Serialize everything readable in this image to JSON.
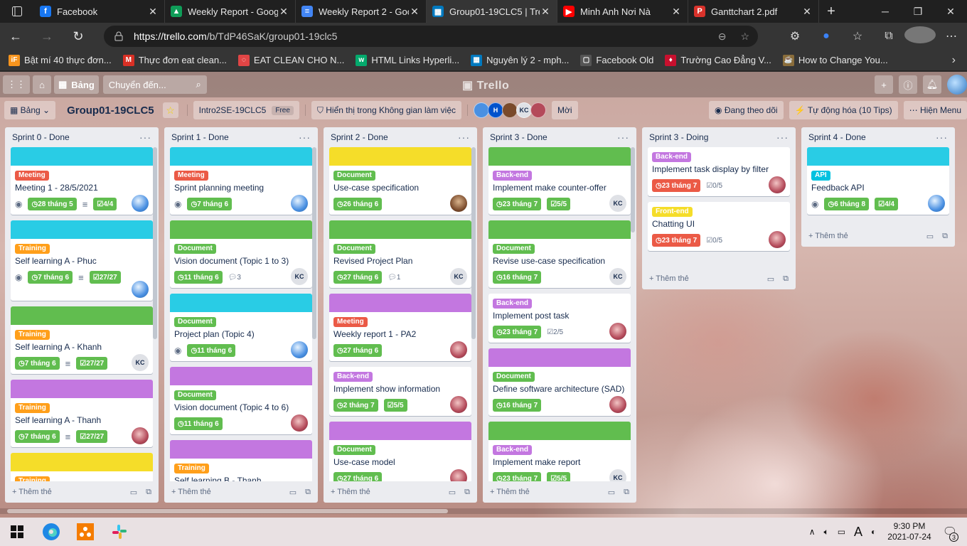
{
  "browser": {
    "tabs": [
      {
        "label": "Facebook",
        "fav_color": "#1877f2",
        "fav_text": "f"
      },
      {
        "label": "Weekly Report - Goog",
        "fav_color": "#0f9d58",
        "fav_text": "▲"
      },
      {
        "label": "Weekly Report 2 - Goo",
        "fav_color": "#4285f4",
        "fav_text": "≡"
      },
      {
        "label": "Group01-19CLC5 | Tre",
        "fav_color": "#0079bf",
        "fav_text": "▦"
      },
      {
        "label": "Minh Anh Nơi Nà",
        "fav_color": "#ff0000",
        "fav_text": "▶"
      },
      {
        "label": "Ganttchart 2.pdf",
        "fav_color": "#d9322b",
        "fav_text": "P"
      }
    ],
    "url_host": "https://trello.com",
    "url_path": "/b/TdP46SaK/group01-19clc5",
    "bookmarks": [
      {
        "label": "Bật mí 40 thực đơn...",
        "fav_color": "#f7941d",
        "fav_text": "iF"
      },
      {
        "label": "Thực đơn eat clean...",
        "fav_color": "#d93025",
        "fav_text": "M"
      },
      {
        "label": "EAT CLEAN CHO N...",
        "fav_color": "#e04545",
        "fav_text": "◌"
      },
      {
        "label": "HTML Links Hyperli...",
        "fav_color": "#04aa6d",
        "fav_text": "w"
      },
      {
        "label": "Nguyên lý 2 - mph...",
        "fav_color": "#0079bf",
        "fav_text": "▦"
      },
      {
        "label": "Facebook Old",
        "fav_color": "#555555",
        "fav_text": "▢"
      },
      {
        "label": "Trường Cao Đẳng V...",
        "fav_color": "#c8102e",
        "fav_text": "♦"
      },
      {
        "label": "How to Change You...",
        "fav_color": "#8a6d3b",
        "fav_text": "☕"
      }
    ]
  },
  "trello": {
    "home_label": "Bảng",
    "search_placeholder": "Chuyển đến...",
    "logo": "Trello",
    "board_btn": "Bảng",
    "board_title": "Group01-19CLC5",
    "workspace": "Intro2SE-19CLC5",
    "free_badge": "Free",
    "visibility": "Hiển thị trong Không gian làm việc",
    "invite": "Mời",
    "following": "Đang theo dõi",
    "automation": "Tự động hóa (10 Tips)",
    "menu": "Hiện Menu",
    "add_card": "Thêm thẻ",
    "members": [
      {
        "text": "",
        "color": "#4a90e2"
      },
      {
        "text": "H",
        "color": "#0052cc"
      },
      {
        "text": "",
        "color": "#7a4a2b"
      },
      {
        "text": "KC",
        "color": "#dfe1e6"
      },
      {
        "text": "",
        "color": "#b44a5a"
      }
    ]
  },
  "colors": {
    "green": "#61bd4f",
    "cyan": "#29cce5",
    "purple": "#c377e0",
    "yellow": "#f5dd29",
    "red": "#eb5a46",
    "orange": "#ff9f1a",
    "sky": "#00c2e0"
  },
  "lists": [
    {
      "title": "Sprint 0 - Done",
      "cards": [
        {
          "cover": "cyan",
          "label": "Meeting",
          "label_color": "red",
          "title": "Meeting 1 - 28/5/2021",
          "eye": true,
          "date": "28 tháng 5",
          "desc": true,
          "check": "4/4",
          "avatar": "blue"
        },
        {
          "cover": "cyan",
          "label": "Training",
          "label_color": "orange",
          "title": "Self learning A - Phuc",
          "eye": true,
          "date": "7 tháng 6",
          "desc": true,
          "check": "27/27",
          "avatar": "blue",
          "avatar_row": true
        },
        {
          "cover": "green",
          "label": "Training",
          "label_color": "orange",
          "title": "Self learning A - Khanh",
          "date": "7 tháng 6",
          "desc": true,
          "check": "27/27",
          "avatar": "kc"
        },
        {
          "cover": "purple",
          "label": "Training",
          "label_color": "orange",
          "title": "Self learning A - Thanh",
          "date": "7 tháng 6",
          "desc": true,
          "check": "27/27",
          "avatar": "flower"
        },
        {
          "cover": "yellow",
          "label": "Training",
          "label_color": "orange",
          "title": "",
          "partial": true
        }
      ]
    },
    {
      "title": "Sprint 1 - Done",
      "cards": [
        {
          "cover": "cyan",
          "label": "Meeting",
          "label_color": "red",
          "title": "Sprint planning meeting",
          "eye": true,
          "date": "7 tháng 6",
          "avatar": "blue"
        },
        {
          "cover": "green",
          "label": "Document",
          "label_color": "green",
          "title": "Vision document (Topic 1 to 3)",
          "date": "11 tháng 6",
          "comments": "3",
          "avatar": "kc"
        },
        {
          "cover": "cyan",
          "label": "Document",
          "label_color": "green",
          "title": "Project plan (Topic 4)",
          "eye": true,
          "date": "11 tháng 6",
          "avatar": "blue"
        },
        {
          "cover": "purple",
          "label": "Document",
          "label_color": "green",
          "title": "Vision document (Topic 4 to 6)",
          "date": "11 tháng 6",
          "avatar": "flower"
        },
        {
          "cover": "purple",
          "label": "Training",
          "label_color": "orange",
          "title": "Self learning B - Thanh",
          "partial": true
        }
      ]
    },
    {
      "title": "Sprint 2 - Done",
      "cards": [
        {
          "cover": "yellow",
          "label": "Document",
          "label_color": "green",
          "title": "Use-case specification",
          "date": "26 tháng 6",
          "avatar": "photo"
        },
        {
          "cover": "green",
          "label": "Document",
          "label_color": "green",
          "title": "Revised Project Plan",
          "date": "27 tháng 6",
          "comments": "1",
          "avatar": "kc"
        },
        {
          "cover": "purple",
          "label": "Meeting",
          "label_color": "red",
          "title": "Weekly report 1 - PA2",
          "date": "27 tháng 6",
          "avatar": "flower"
        },
        {
          "cover": "",
          "label": "Back-end",
          "label_color": "purple",
          "title": "Implement show information",
          "date": "2 tháng 7",
          "check": "5/5",
          "avatar": "flower"
        },
        {
          "cover": "purple",
          "label": "Document",
          "label_color": "green",
          "title": "Use-case model",
          "date": "27 tháng 6",
          "avatar": "flower"
        }
      ]
    },
    {
      "title": "Sprint 3 - Done",
      "cards": [
        {
          "cover": "green",
          "label": "Back-end",
          "label_color": "purple",
          "title": "Implement make counter-offer",
          "date": "23 tháng 7",
          "check": "5/5",
          "avatar": "kc"
        },
        {
          "cover": "green",
          "label": "Document",
          "label_color": "green",
          "title": "Revise use-case specification",
          "date": "16 tháng 7",
          "avatar": "kc"
        },
        {
          "cover": "",
          "label": "Back-end",
          "label_color": "purple",
          "title": "Implement post task",
          "date": "23 tháng 7",
          "check_plain": "2/5",
          "avatar": "flower"
        },
        {
          "cover": "purple",
          "label": "Document",
          "label_color": "green",
          "title": "Define software architecture (SAD)",
          "date": "16 tháng 7",
          "avatar": "flower"
        },
        {
          "cover": "green",
          "label": "Back-end",
          "label_color": "purple",
          "title": "Implement make report",
          "date": "23 tháng 7",
          "check": "5/5",
          "avatar": "kc"
        }
      ]
    },
    {
      "title": "Sprint 3 - Doing",
      "cards": [
        {
          "cover": "",
          "label": "Back-end",
          "label_color": "purple",
          "title": "Implement task display by filter",
          "date": "23 tháng 7",
          "date_red": true,
          "check_plain": "0/5",
          "avatar": "flower"
        },
        {
          "cover": "",
          "label": "Front-end",
          "label_color": "yellow",
          "title": "Chatting UI",
          "date": "23 tháng 7",
          "date_red": true,
          "check_plain": "0/5",
          "avatar": "flower"
        }
      ]
    },
    {
      "title": "Sprint 4 - Done",
      "cards": [
        {
          "cover": "cyan",
          "label": "API",
          "label_color": "sky",
          "title": "Feedback API",
          "eye": true,
          "date": "6 tháng 8",
          "check": "4/4",
          "avatar": "blue"
        }
      ]
    }
  ],
  "taskbar": {
    "time": "9:30 PM",
    "date": "2021-07-24",
    "lang": "A",
    "notif_count": "3"
  }
}
